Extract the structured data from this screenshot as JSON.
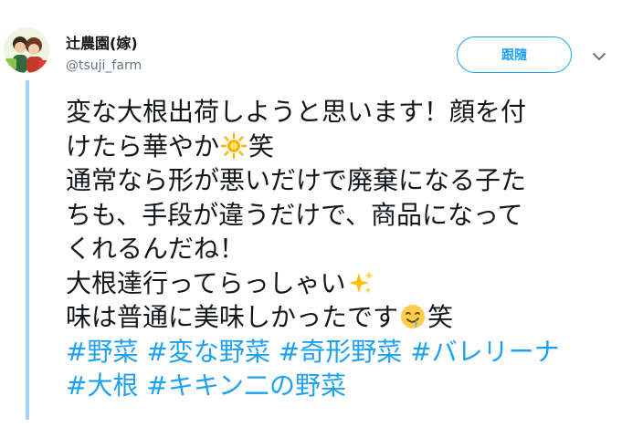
{
  "author": {
    "display_name": "辻農園(嫁)",
    "handle": "@tsuji_farm"
  },
  "actions": {
    "follow_label": "跟隨"
  },
  "icons": {
    "more": "chevron-down-icon",
    "emoji_1": "glowing-star",
    "emoji_2": "sparkles",
    "emoji_3": "drooling-face"
  },
  "tweet": {
    "line1": "変な大根出荷しようと思います！顔を付",
    "line2a": "けたら華やか",
    "line2b": "笑",
    "line3": "通常なら形が悪いだけで廃棄になる子た",
    "line4": "ちも、手段が違うだけで、商品になって",
    "line5": "くれるんだね！",
    "line6": "大根達行ってらっしゃい",
    "line7a": "味は普通に美味しかったです",
    "line7b": "笑",
    "hashtags": [
      "#野菜",
      "#変な野菜",
      "#奇形野菜",
      "#バレリーナ",
      "#大根",
      "#キキン二の野菜"
    ]
  },
  "colors": {
    "link": "#1da1f2",
    "thread_line": "#a3d4f5",
    "secondary_text": "#657786"
  }
}
